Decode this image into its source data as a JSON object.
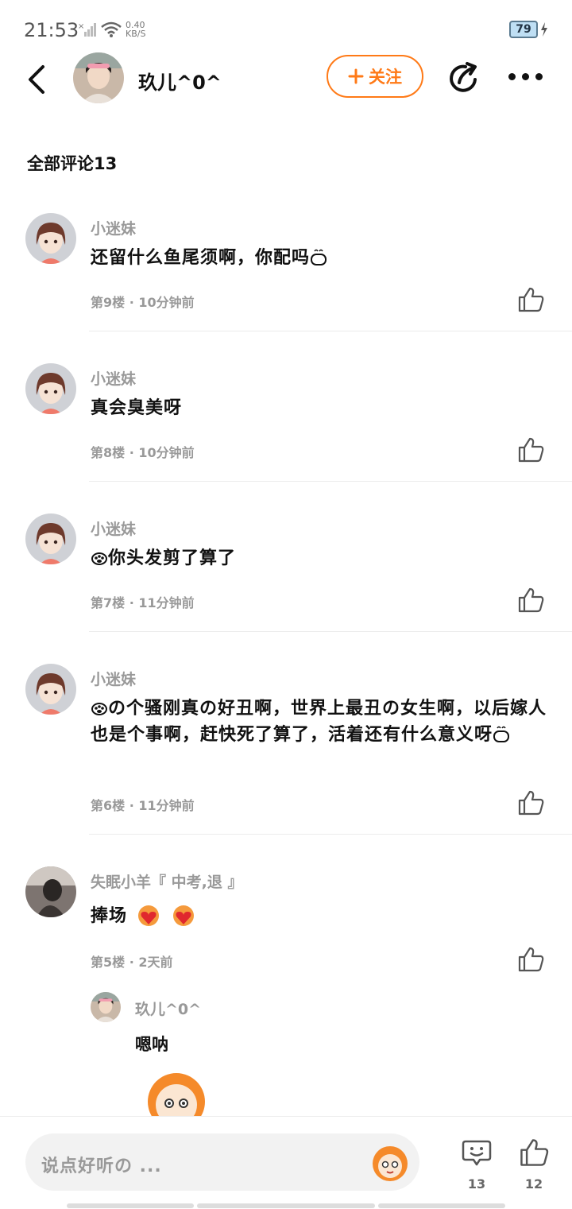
{
  "status_bar": {
    "time": "21:53",
    "net_speed_value": "0.40",
    "net_speed_unit": "KB/S",
    "battery": "79"
  },
  "header": {
    "username": "玖儿^0^",
    "follow_label": "关注"
  },
  "comments_section": {
    "title": "全部评论13"
  },
  "comments": [
    {
      "user": "小迷妹",
      "text": "还留什么鱼尾须啊，你配吗",
      "floor": "第9楼",
      "time": "10分钟前"
    },
    {
      "user": "小迷妹",
      "text": "真会臭美呀",
      "floor": "第8楼",
      "time": "10分钟前"
    },
    {
      "user": "小迷妹",
      "text": "你头发剪了算了",
      "floor": "第7楼",
      "time": "11分钟前"
    },
    {
      "user": "小迷妹",
      "text": "の个骚刚真の好丑啊，世界上最丑の女生啊，以后嫁人也是个事啊，赶快死了算了，活着还有什么意义呀",
      "floor": "第6楼",
      "time": "11分钟前"
    },
    {
      "user": "失眠小羊『 中考,退 』",
      "text": "捧场",
      "floor": "第5楼",
      "time": "2天前"
    }
  ],
  "reply": {
    "user": "玖儿^0^",
    "text": "嗯呐"
  },
  "bottom_bar": {
    "input_placeholder": "说点好听の ...",
    "comment_count": "13",
    "like_count": "12"
  },
  "colors": {
    "accent": "#ff7a17",
    "muted_text": "#999999",
    "divider": "#ececec"
  }
}
